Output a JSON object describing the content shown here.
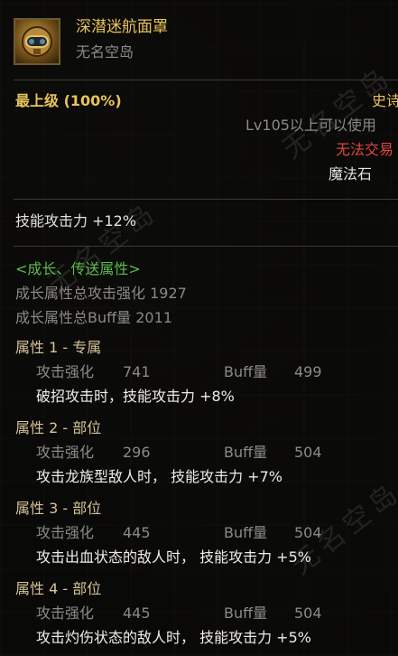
{
  "item": {
    "name": "深潜迷航面罩",
    "subtitle": "无名空岛",
    "icon": "diving-mask-icon",
    "grade": "最上级 (100%)",
    "rarity": "史诗",
    "level_req": "Lv105以上可以使用",
    "trade": "无法交易",
    "type": "魔法石"
  },
  "skill_attack": "技能攻击力   +12%",
  "growth": {
    "header": "<成长、传送属性>",
    "total_attack": "成长属性总攻击强化 1927",
    "total_buff": "成长属性总Buff量 2011"
  },
  "attributes": [
    {
      "title": "属性 1 - 专属",
      "atk_label": "攻击强化",
      "atk_value": "741",
      "buff_label": "Buff量",
      "buff_value": "499",
      "effect": "破招攻击时，技能攻击力 +8%"
    },
    {
      "title": "属性 2 - 部位",
      "atk_label": "攻击强化",
      "atk_value": "296",
      "buff_label": "Buff量",
      "buff_value": "504",
      "effect": "攻击龙族型敌人时， 技能攻击力 +7%"
    },
    {
      "title": "属性 3 - 部位",
      "atk_label": "攻击强化",
      "atk_value": "445",
      "buff_label": "Buff量",
      "buff_value": "504",
      "effect": "攻击出血状态的敌人时， 技能攻击力 +5%"
    },
    {
      "title": "属性 4 - 部位",
      "atk_label": "攻击强化",
      "atk_value": "445",
      "buff_label": "Buff量",
      "buff_value": "504",
      "effect": "攻击灼伤状态的敌人时， 技能攻击力 +5%"
    }
  ],
  "watermark": "无名空岛",
  "colors": {
    "gold": "#e8c45a",
    "green": "#5dbb4d",
    "red": "#e0463e",
    "dim": "#8c8a85"
  }
}
